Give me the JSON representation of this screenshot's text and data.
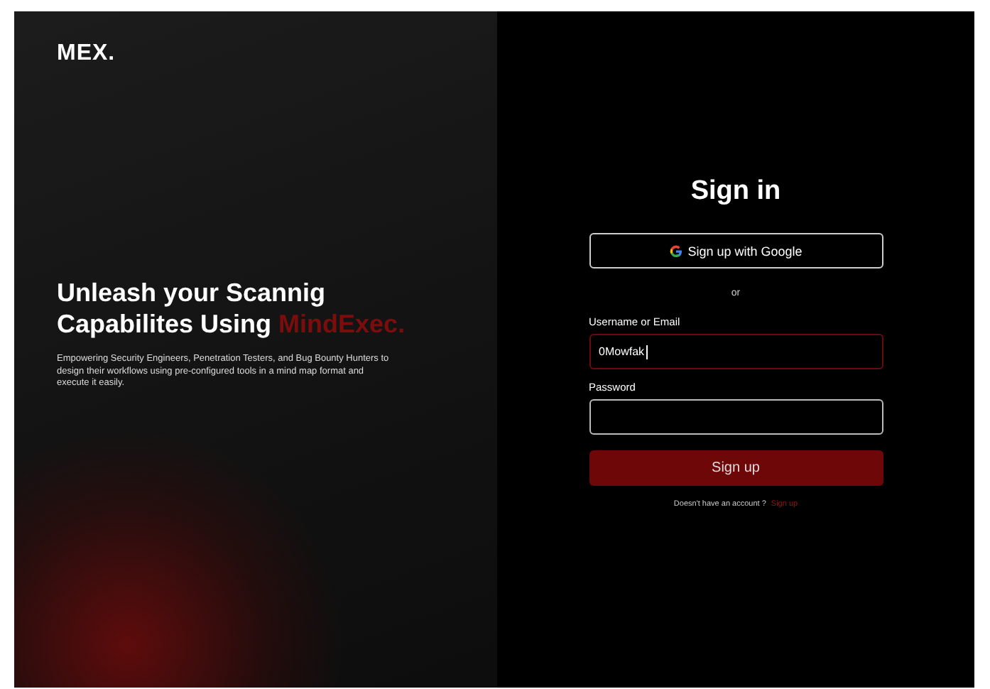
{
  "logo": "MEX.",
  "hero": {
    "headline": "Unleash your Scannig Capabilites Using",
    "headline_highlight": "MindExec.",
    "description": "Empowering Security Engineers, Penetration Testers, and Bug Bounty Hunters to design their workflows using pre-configured tools in a mind map format and execute it easily."
  },
  "form": {
    "title": "Sign in",
    "google_button": "Sign up with Google",
    "divider": "or",
    "fields": [
      {
        "label": "Username or Email",
        "value": "0Mowfak",
        "focused": true
      },
      {
        "label": "Password",
        "focused": false
      }
    ],
    "submit": "Sign up",
    "footer_text": "Doesn't have an account ?",
    "footer_link": "Sign up"
  }
}
